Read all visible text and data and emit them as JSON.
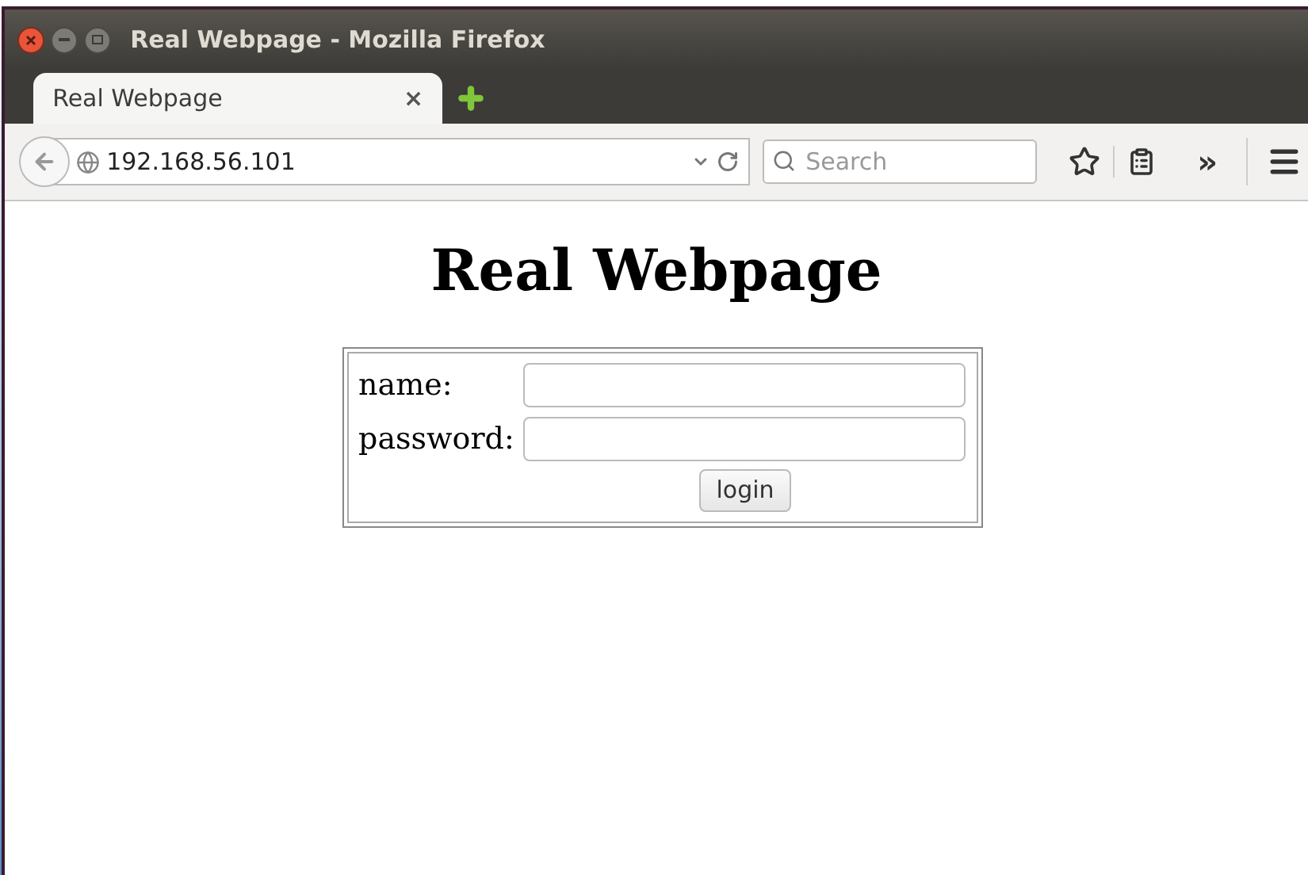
{
  "window": {
    "title": "Real Webpage - Mozilla Firefox"
  },
  "tabs": [
    {
      "label": "Real Webpage",
      "selected": true,
      "close": "×"
    }
  ],
  "address_bar": {
    "url": "192.168.56.101"
  },
  "search": {
    "placeholder": "Search"
  },
  "toolbar": {
    "overflow": "»"
  },
  "page": {
    "heading": "Real Webpage",
    "form": {
      "fields": [
        {
          "label": "name:"
        },
        {
          "label": "password:"
        }
      ],
      "button": "login"
    }
  }
}
